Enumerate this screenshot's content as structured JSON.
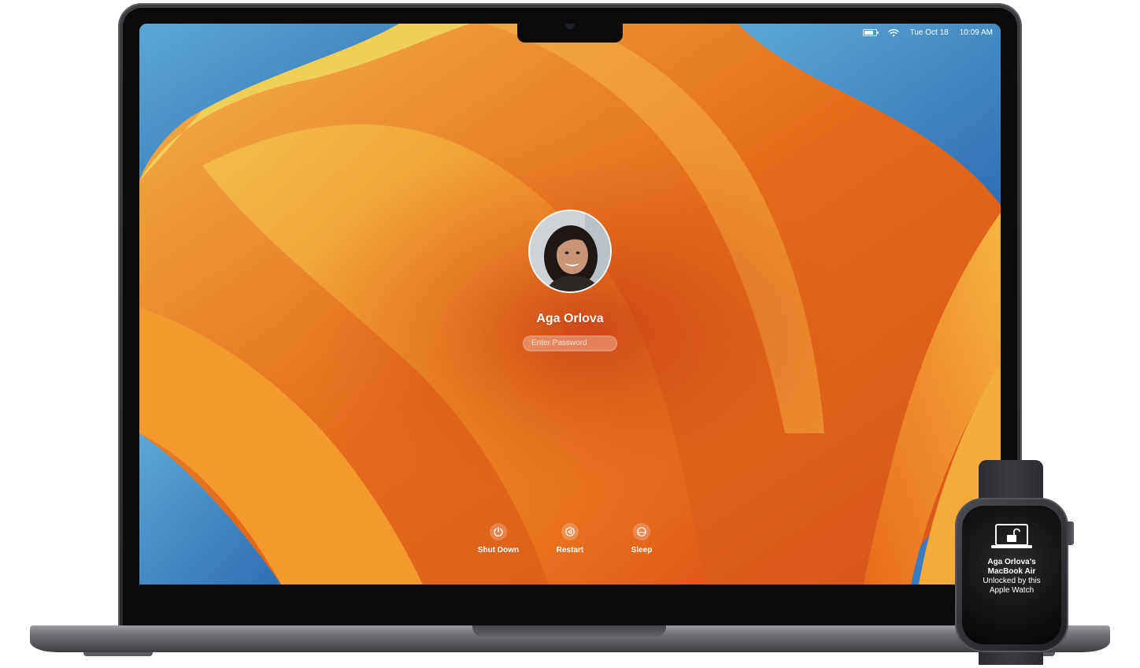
{
  "menubar": {
    "battery_icon": "battery-icon",
    "wifi_icon": "wifi-icon",
    "date": "Tue Oct 18",
    "time": "10:09 AM"
  },
  "login": {
    "user_name": "Aga Orlova",
    "password_placeholder": "Enter Password"
  },
  "power_controls": {
    "shut_down": {
      "label": "Shut Down",
      "icon": "power-icon"
    },
    "restart": {
      "label": "Restart",
      "icon": "restart-icon"
    },
    "sleep": {
      "label": "Sleep",
      "icon": "sleep-icon"
    }
  },
  "watch": {
    "icon": "unlocked-laptop-icon",
    "title_line1": "Aga Orlova's",
    "title_line2": "MacBook Air",
    "subtitle_line1": "Unlocked by this",
    "subtitle_line2": "Apple Watch"
  },
  "colors": {
    "wallpaper_orange": "#e6761c",
    "wallpaper_blue": "#3f86c7",
    "wallpaper_yellow": "#f3c04a",
    "laptop_body": "#2a2b2e"
  }
}
